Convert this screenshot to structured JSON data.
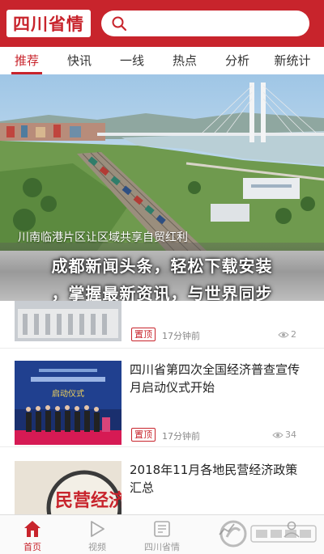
{
  "app": {
    "logo_text": "四川省情"
  },
  "search": {
    "icon": "search-icon",
    "placeholder": ""
  },
  "tabs": [
    {
      "label": "推荐",
      "active": true
    },
    {
      "label": "快讯"
    },
    {
      "label": "一线"
    },
    {
      "label": "热点"
    },
    {
      "label": "分析"
    },
    {
      "label": "新统计"
    }
  ],
  "hero": {
    "caption": "川南临港片区让区域共享自贸红利"
  },
  "overlay": {
    "line1": "成都新闻头条，轻松下载安装",
    "line2": "，掌握最新资讯，与世界同步"
  },
  "news": [
    {
      "title": "",
      "badge": "置顶",
      "time": "17分钟前",
      "views": "2"
    },
    {
      "title": "四川省第四次全国经济普查宣传月启动仪式开始",
      "badge": "置顶",
      "time": "17分钟前",
      "views": "34",
      "thumb_text": "启动仪式"
    },
    {
      "title": "2018年11月各地民营经济政策汇总",
      "thumb_text": "民营经济"
    }
  ],
  "bottom_nav": [
    {
      "label": "首页",
      "icon": "home-icon",
      "active": true
    },
    {
      "label": "视频",
      "icon": "play-icon"
    },
    {
      "label": "四川省情",
      "icon": "newspaper-icon"
    },
    {
      "label": "",
      "icon": "chart-icon"
    },
    {
      "label": "",
      "icon": "user-icon"
    }
  ],
  "colors": {
    "brand": "#c8242c",
    "tab_active": "#c8242c"
  }
}
